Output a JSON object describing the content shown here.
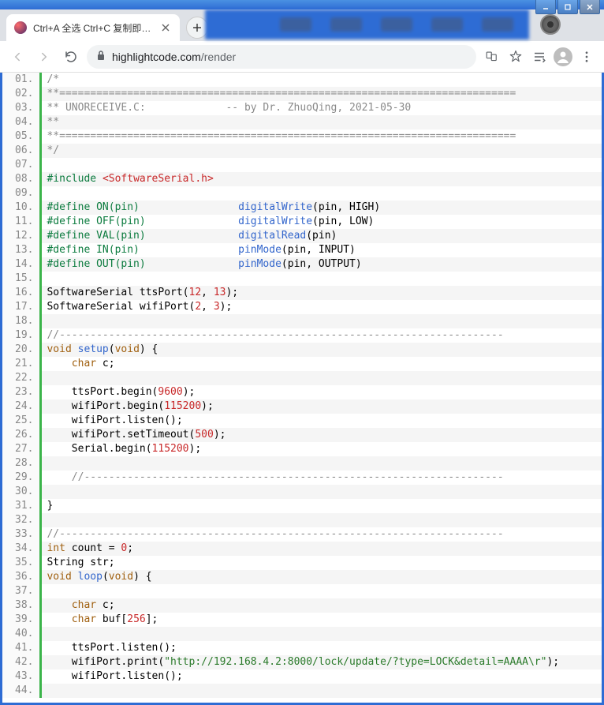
{
  "window": {
    "min_tooltip": "Minimize",
    "max_tooltip": "Maximize",
    "close_tooltip": "Close"
  },
  "tab": {
    "title": "Ctrl+A 全选 Ctrl+C 复制即可 - C"
  },
  "toolbar": {
    "url_domain": "highlightcode.com",
    "url_path": "/render"
  },
  "code": {
    "lines": [
      {
        "n": "01.",
        "segs": [
          {
            "cls": "tok-comment",
            "t": "/*"
          }
        ]
      },
      {
        "n": "02.",
        "segs": [
          {
            "cls": "tok-comment",
            "t": "**=========================================================================="
          }
        ]
      },
      {
        "n": "03.",
        "segs": [
          {
            "cls": "tok-comment",
            "t": "** UNORECEIVE.C:             -- by Dr. ZhuoQing, 2021-05-30"
          }
        ]
      },
      {
        "n": "04.",
        "segs": [
          {
            "cls": "tok-comment",
            "t": "**"
          }
        ]
      },
      {
        "n": "05.",
        "segs": [
          {
            "cls": "tok-comment",
            "t": "**=========================================================================="
          }
        ]
      },
      {
        "n": "06.",
        "segs": [
          {
            "cls": "tok-comment",
            "t": "*/"
          }
        ]
      },
      {
        "n": "07.",
        "segs": []
      },
      {
        "n": "08.",
        "segs": [
          {
            "cls": "tok-pre",
            "t": "#include "
          },
          {
            "cls": "tok-inc",
            "t": "<SoftwareSerial.h>"
          }
        ]
      },
      {
        "n": "09.",
        "segs": []
      },
      {
        "n": "10.",
        "segs": [
          {
            "cls": "tok-pre",
            "t": "#define ON(pin)"
          },
          {
            "t": "                "
          },
          {
            "cls": "tok-fn",
            "t": "digitalWrite"
          },
          {
            "t": "(pin, HIGH)"
          }
        ]
      },
      {
        "n": "11.",
        "segs": [
          {
            "cls": "tok-pre",
            "t": "#define OFF(pin)"
          },
          {
            "t": "               "
          },
          {
            "cls": "tok-fn",
            "t": "digitalWrite"
          },
          {
            "t": "(pin, LOW)"
          }
        ]
      },
      {
        "n": "12.",
        "segs": [
          {
            "cls": "tok-pre",
            "t": "#define VAL(pin)"
          },
          {
            "t": "               "
          },
          {
            "cls": "tok-fn",
            "t": "digitalRead"
          },
          {
            "t": "(pin)"
          }
        ]
      },
      {
        "n": "13.",
        "segs": [
          {
            "cls": "tok-pre",
            "t": "#define IN(pin)"
          },
          {
            "t": "                "
          },
          {
            "cls": "tok-fn",
            "t": "pinMode"
          },
          {
            "t": "(pin, INPUT)"
          }
        ]
      },
      {
        "n": "14.",
        "segs": [
          {
            "cls": "tok-pre",
            "t": "#define OUT(pin)"
          },
          {
            "t": "               "
          },
          {
            "cls": "tok-fn",
            "t": "pinMode"
          },
          {
            "t": "(pin, OUTPUT)"
          }
        ]
      },
      {
        "n": "15.",
        "segs": []
      },
      {
        "n": "16.",
        "segs": [
          {
            "t": "SoftwareSerial ttsPort("
          },
          {
            "cls": "tok-num",
            "t": "12"
          },
          {
            "t": ", "
          },
          {
            "cls": "tok-num",
            "t": "13"
          },
          {
            "t": ");"
          }
        ]
      },
      {
        "n": "17.",
        "segs": [
          {
            "t": "SoftwareSerial wifiPort("
          },
          {
            "cls": "tok-num",
            "t": "2"
          },
          {
            "t": ", "
          },
          {
            "cls": "tok-num",
            "t": "3"
          },
          {
            "t": ");"
          }
        ]
      },
      {
        "n": "18.",
        "segs": []
      },
      {
        "n": "19.",
        "segs": [
          {
            "cls": "tok-comment",
            "t": "//------------------------------------------------------------------------"
          }
        ]
      },
      {
        "n": "20.",
        "segs": [
          {
            "cls": "tok-type",
            "t": "void"
          },
          {
            "t": " "
          },
          {
            "cls": "tok-fn",
            "t": "setup"
          },
          {
            "t": "("
          },
          {
            "cls": "tok-type",
            "t": "void"
          },
          {
            "t": ") {"
          }
        ]
      },
      {
        "n": "21.",
        "segs": [
          {
            "t": "    "
          },
          {
            "cls": "tok-type",
            "t": "char"
          },
          {
            "t": " c;"
          }
        ]
      },
      {
        "n": "22.",
        "segs": []
      },
      {
        "n": "23.",
        "segs": [
          {
            "t": "    ttsPort.begin("
          },
          {
            "cls": "tok-num",
            "t": "9600"
          },
          {
            "t": ");"
          }
        ]
      },
      {
        "n": "24.",
        "segs": [
          {
            "t": "    wifiPort.begin("
          },
          {
            "cls": "tok-num",
            "t": "115200"
          },
          {
            "t": ");"
          }
        ]
      },
      {
        "n": "25.",
        "segs": [
          {
            "t": "    wifiPort.listen();"
          }
        ]
      },
      {
        "n": "26.",
        "segs": [
          {
            "t": "    wifiPort.setTimeout("
          },
          {
            "cls": "tok-num",
            "t": "500"
          },
          {
            "t": ");"
          }
        ]
      },
      {
        "n": "27.",
        "segs": [
          {
            "t": "    Serial.begin("
          },
          {
            "cls": "tok-num",
            "t": "115200"
          },
          {
            "t": ");"
          }
        ]
      },
      {
        "n": "28.",
        "segs": []
      },
      {
        "n": "29.",
        "segs": [
          {
            "t": "    "
          },
          {
            "cls": "tok-comment",
            "t": "//--------------------------------------------------------------------"
          }
        ]
      },
      {
        "n": "30.",
        "segs": []
      },
      {
        "n": "31.",
        "segs": [
          {
            "t": "}"
          }
        ]
      },
      {
        "n": "32.",
        "segs": []
      },
      {
        "n": "33.",
        "segs": [
          {
            "cls": "tok-comment",
            "t": "//------------------------------------------------------------------------"
          }
        ]
      },
      {
        "n": "34.",
        "segs": [
          {
            "cls": "tok-type",
            "t": "int"
          },
          {
            "t": " count = "
          },
          {
            "cls": "tok-num",
            "t": "0"
          },
          {
            "t": ";"
          }
        ]
      },
      {
        "n": "35.",
        "segs": [
          {
            "t": "String str;"
          }
        ]
      },
      {
        "n": "36.",
        "segs": [
          {
            "cls": "tok-type",
            "t": "void"
          },
          {
            "t": " "
          },
          {
            "cls": "tok-fn",
            "t": "loop"
          },
          {
            "t": "("
          },
          {
            "cls": "tok-type",
            "t": "void"
          },
          {
            "t": ") {"
          }
        ]
      },
      {
        "n": "37.",
        "segs": []
      },
      {
        "n": "38.",
        "segs": [
          {
            "t": "    "
          },
          {
            "cls": "tok-type",
            "t": "char"
          },
          {
            "t": " c;"
          }
        ]
      },
      {
        "n": "39.",
        "segs": [
          {
            "t": "    "
          },
          {
            "cls": "tok-type",
            "t": "char"
          },
          {
            "t": " buf["
          },
          {
            "cls": "tok-num",
            "t": "256"
          },
          {
            "t": "];"
          }
        ]
      },
      {
        "n": "40.",
        "segs": []
      },
      {
        "n": "41.",
        "segs": [
          {
            "t": "    ttsPort.listen();"
          }
        ]
      },
      {
        "n": "42.",
        "segs": [
          {
            "t": "    wifiPort.print("
          },
          {
            "cls": "tok-str",
            "t": "\"http://192.168.4.2:8000/lock/update/?type=LOCK&detail=AAAA\\r\""
          },
          {
            "t": ");"
          }
        ]
      },
      {
        "n": "43.",
        "segs": [
          {
            "t": "    wifiPort.listen();"
          }
        ]
      },
      {
        "n": "44.",
        "segs": []
      }
    ]
  }
}
